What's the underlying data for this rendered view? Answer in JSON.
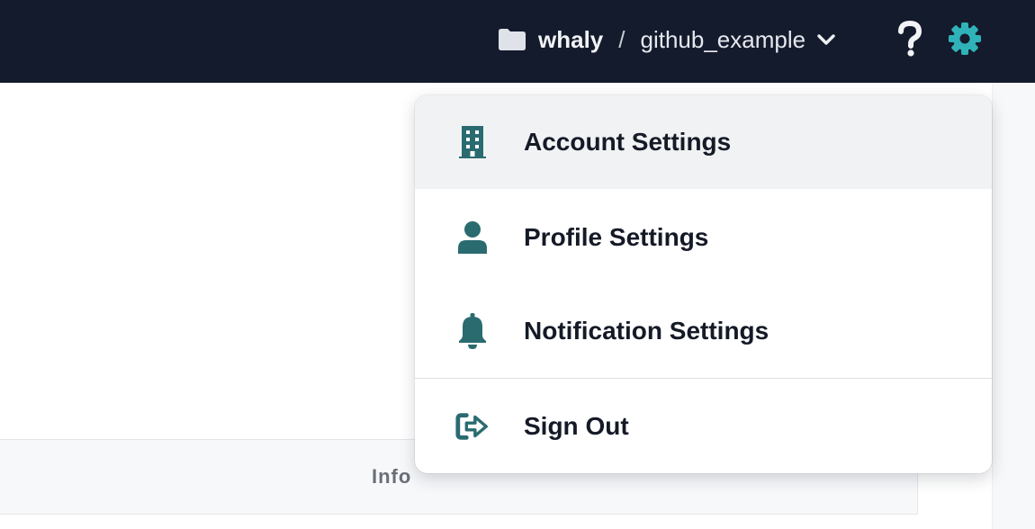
{
  "header": {
    "org": "whaly",
    "separator": "/",
    "project": "github_example",
    "icons": {
      "folder": "folder-icon",
      "chevron": "chevron-down-icon",
      "help": "question-icon",
      "settings": "gear-icon"
    },
    "accent": "#2fb3b8"
  },
  "menu": {
    "items": [
      {
        "label": "Account Settings",
        "icon": "building-icon",
        "active": true
      },
      {
        "label": "Profile Settings",
        "icon": "user-icon",
        "active": false
      },
      {
        "label": "Notification Settings",
        "icon": "bell-icon",
        "active": false
      },
      {
        "label": "Sign Out",
        "icon": "sign-out-icon",
        "active": false
      }
    ],
    "icon_color": "#2a6b70"
  },
  "table": {
    "header_info": "Info"
  }
}
